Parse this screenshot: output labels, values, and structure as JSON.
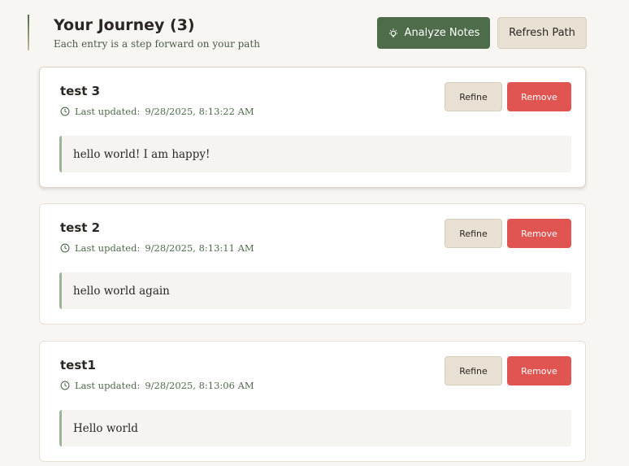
{
  "header": {
    "title": "Your Journey (3)",
    "subtitle": "Each entry is a step forward on your path",
    "analyze_label": "Analyze Notes",
    "analyze_icon": "lightbulb-icon",
    "refresh_label": "Refresh Path"
  },
  "colors": {
    "primary_green": "#4e6b4a",
    "remove_red": "#e05551",
    "neutral_button": "#e8e0d3",
    "page_background": "#f8f6f3",
    "note_accent": "#9cb59a"
  },
  "entries": [
    {
      "title": "test 3",
      "updated_prefix": "Last updated:",
      "updated_time": "9/28/2025, 8:13:22 AM",
      "body": "hello world! I am happy!",
      "refine_label": "Refine",
      "remove_label": "Remove"
    },
    {
      "title": "test 2",
      "updated_prefix": "Last updated:",
      "updated_time": "9/28/2025, 8:13:11 AM",
      "body": "hello world again",
      "refine_label": "Refine",
      "remove_label": "Remove"
    },
    {
      "title": "test1",
      "updated_prefix": "Last updated:",
      "updated_time": "9/28/2025, 8:13:06 AM",
      "body": "Hello world",
      "refine_label": "Refine",
      "remove_label": "Remove"
    }
  ]
}
